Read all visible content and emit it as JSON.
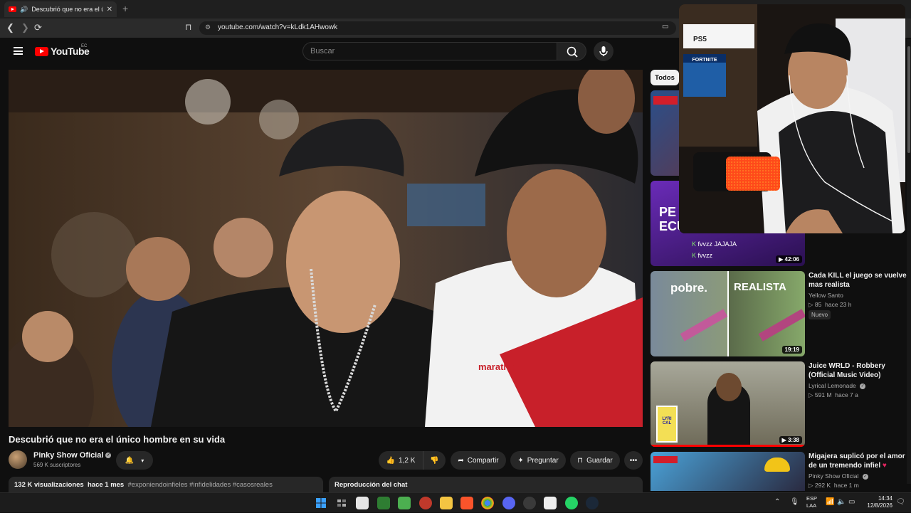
{
  "browser": {
    "tab_title": "Descubrió que no era el únic",
    "new_tab": "+",
    "url": "youtube.com/watch?v=kLdk1AHwowk"
  },
  "youtube": {
    "logo_text": "YouTube",
    "country_code": "EC",
    "search_placeholder": "Buscar",
    "accent": "#ff0000"
  },
  "video": {
    "title": "Descubrió que no era el único hombre en su vida",
    "shirt_text": "marathon",
    "channel": {
      "name": "Pinky Show Oficial",
      "subscribers": "569 K suscriptores"
    },
    "actions": {
      "likes": "1,2 K",
      "share": "Compartir",
      "ask": "Preguntar",
      "save": "Guardar"
    },
    "description": {
      "views": "132 K visualizaciones",
      "age": "hace 1 mes",
      "hashtags": "#exponiendoinfieles #infidelidades #casosreales"
    },
    "chat_replay": "Reproducción del chat"
  },
  "sidebar": {
    "chip_all": "Todos",
    "items": [
      {
        "title": "",
        "channel": "",
        "meta": "",
        "duration": "",
        "thumb_color": "#3b4d6b"
      },
      {
        "title": "",
        "channel": "",
        "meta": "",
        "duration": "42:06",
        "thumb_text": "PE ECU",
        "chat_line": "fvvzz JAJAJA",
        "chat_line2": "fvvzz",
        "thumb_color": "#3a1b6e"
      },
      {
        "title": "Cada KILL el juego se vuelve mas realista",
        "channel": "Yellow Santo",
        "views": "85",
        "age": "hace 23 h",
        "badge": "Nuevo",
        "duration": "19:19",
        "thumb_left": "pobre.",
        "thumb_right": "REALISTA"
      },
      {
        "title": "Juice WRLD - Robbery (Official Music Video)",
        "channel": "Lyrical Lemonade",
        "views": "591 M",
        "age": "hace 7 a",
        "duration": "3:38",
        "thumb_sign": "LYRI CAL"
      },
      {
        "title": "Migajera suplicó por el amor de un tremendo infiel",
        "channel": "Pinky Show Oficial",
        "views": "292 K",
        "age": "hace 1 m"
      }
    ]
  },
  "webcam": {
    "console_label": "PS5",
    "game_box": "FORTNITE"
  },
  "taskbar": {
    "lang_top": "ESP",
    "lang_bottom": "LAA",
    "time": "14:34",
    "date": "12/8/2026"
  }
}
